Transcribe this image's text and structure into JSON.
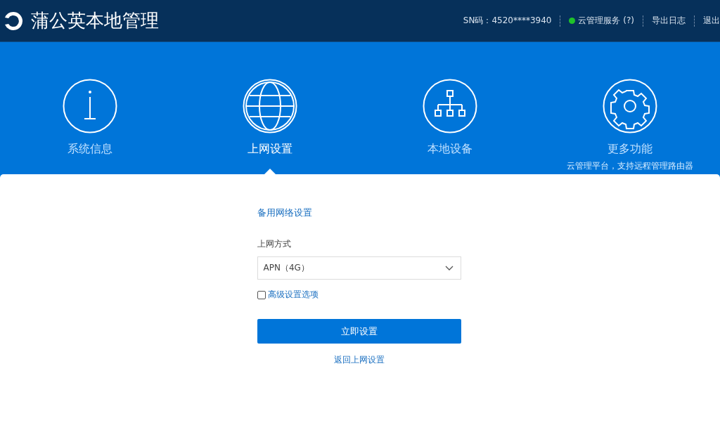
{
  "header": {
    "title": "蒲公英本地管理",
    "sn": "SN码：4520****3940",
    "cloud_service": {
      "label": "云管理服务 (?)",
      "online": true
    },
    "links": [
      "导出日志",
      "退出"
    ]
  },
  "nav": [
    {
      "kind": "info",
      "label": "系统信息",
      "selected": false
    },
    {
      "kind": "globe",
      "label": "上网设置",
      "selected": true
    },
    {
      "kind": "network",
      "label": "本地设备",
      "selected": false
    },
    {
      "kind": "gear",
      "label": "更多功能",
      "subtitle": "云管理平台，支持远程管理路由器",
      "selected": false
    }
  ],
  "form": {
    "heading": "备用网络设置",
    "field_label": "上网方式",
    "select_value": "APN（4G）",
    "advanced": {
      "label": "高级设置选项",
      "checked": false
    },
    "submit": "立即设置",
    "back_link": "返回上网设置"
  }
}
